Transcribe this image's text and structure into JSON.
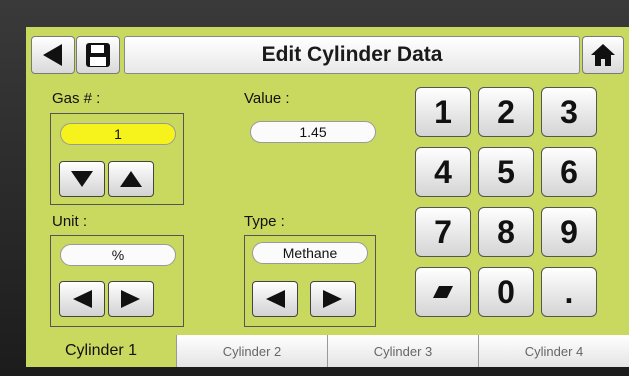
{
  "header": {
    "title": "Edit Cylinder Data",
    "back_icon": "back-arrow-icon",
    "save_icon": "floppy-save-icon",
    "home_icon": "home-icon"
  },
  "gas": {
    "label": "Gas # :",
    "value": "1"
  },
  "value": {
    "label": "Value :",
    "value": "1.45"
  },
  "unit": {
    "label": "Unit :",
    "value": "%"
  },
  "type": {
    "label": "Type :",
    "value": "Methane"
  },
  "keypad": {
    "keys": [
      "1",
      "2",
      "3",
      "4",
      "5",
      "6",
      "7",
      "8",
      "9",
      "",
      "0",
      "."
    ],
    "clear_icon": "eraser-icon"
  },
  "tabs": [
    "Cylinder 1",
    "Cylinder 2",
    "Cylinder 3",
    "Cylinder 4"
  ],
  "active_tab": "Cylinder 1",
  "colors": {
    "screen_bg": "#c9d85e",
    "selected_field": "#f6f21c",
    "bezel": "#2a2a2a"
  }
}
